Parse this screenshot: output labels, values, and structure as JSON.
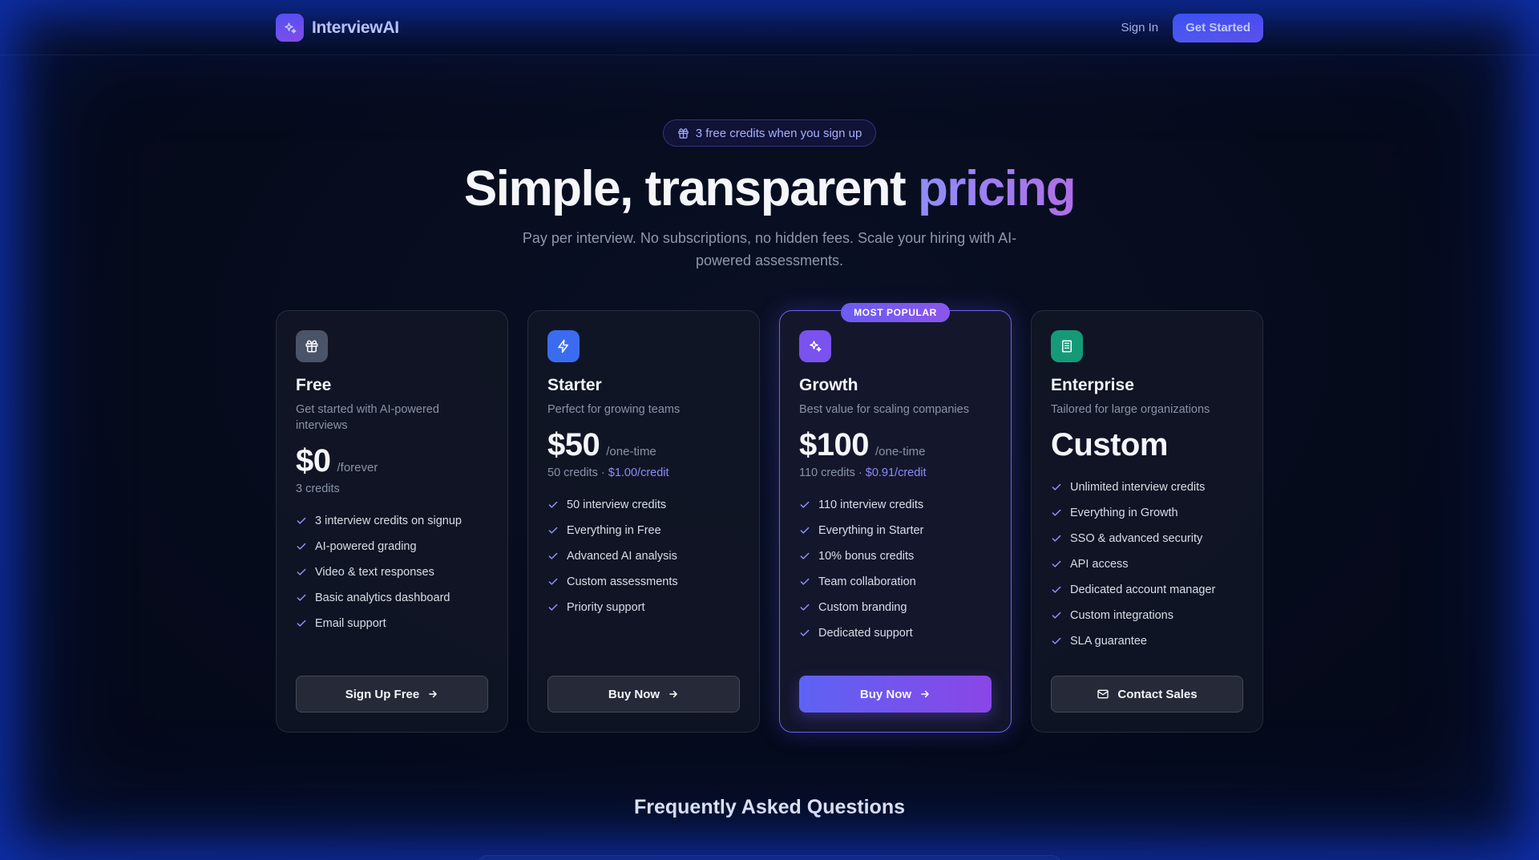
{
  "header": {
    "brand_name": "InterviewAI",
    "sign_in_label": "Sign In",
    "get_started_label": "Get Started"
  },
  "hero": {
    "badge_text": "3 free credits when you sign up",
    "title_main": "Simple, transparent ",
    "title_accent": "pricing",
    "subtitle": "Pay per interview. No subscriptions, no hidden fees. Scale your hiring with AI-powered assessments."
  },
  "plans": [
    {
      "name": "Free",
      "description": "Get started with AI-powered interviews",
      "price": "$0",
      "period": "/forever",
      "credits": "3 credits",
      "per_credit": "",
      "features": [
        "3 interview credits on signup",
        "AI-powered grading",
        "Video & text responses",
        "Basic analytics dashboard",
        "Email support"
      ],
      "button_label": "Sign Up Free",
      "icon": "gift-icon",
      "icon_color": "#4b5368"
    },
    {
      "name": "Starter",
      "description": "Perfect for growing teams",
      "price": "$50",
      "period": "/one-time",
      "credits": "50 credits · ",
      "per_credit": "$1.00/credit",
      "features": [
        "50 interview credits",
        "Everything in Free",
        "Advanced AI analysis",
        "Custom assessments",
        "Priority support"
      ],
      "button_label": "Buy Now",
      "icon": "lightning-icon",
      "icon_color": "#3b6cf0"
    },
    {
      "name": "Growth",
      "description": "Best value for scaling companies",
      "price": "$100",
      "period": "/one-time",
      "credits": "110 credits · ",
      "per_credit": "$0.91/credit",
      "popular_tag": "MOST POPULAR",
      "features": [
        "110 interview credits",
        "Everything in Starter",
        "10% bonus credits",
        "Team collaboration",
        "Custom branding",
        "Dedicated support"
      ],
      "button_label": "Buy Now",
      "icon": "sparkles-icon",
      "icon_color": "#7a52ee"
    },
    {
      "name": "Enterprise",
      "description": "Tailored for large organizations",
      "price": "Custom",
      "features": [
        "Unlimited interview credits",
        "Everything in Growth",
        "SSO & advanced security",
        "API access",
        "Dedicated account manager",
        "Custom integrations",
        "SLA guarantee"
      ],
      "button_label": "Contact Sales",
      "icon": "building-icon",
      "icon_color": "#159a78"
    }
  ],
  "faq": {
    "title": "Frequently Asked Questions"
  },
  "colors": {
    "accent": "#6366f1",
    "check": "#8f95ff"
  }
}
